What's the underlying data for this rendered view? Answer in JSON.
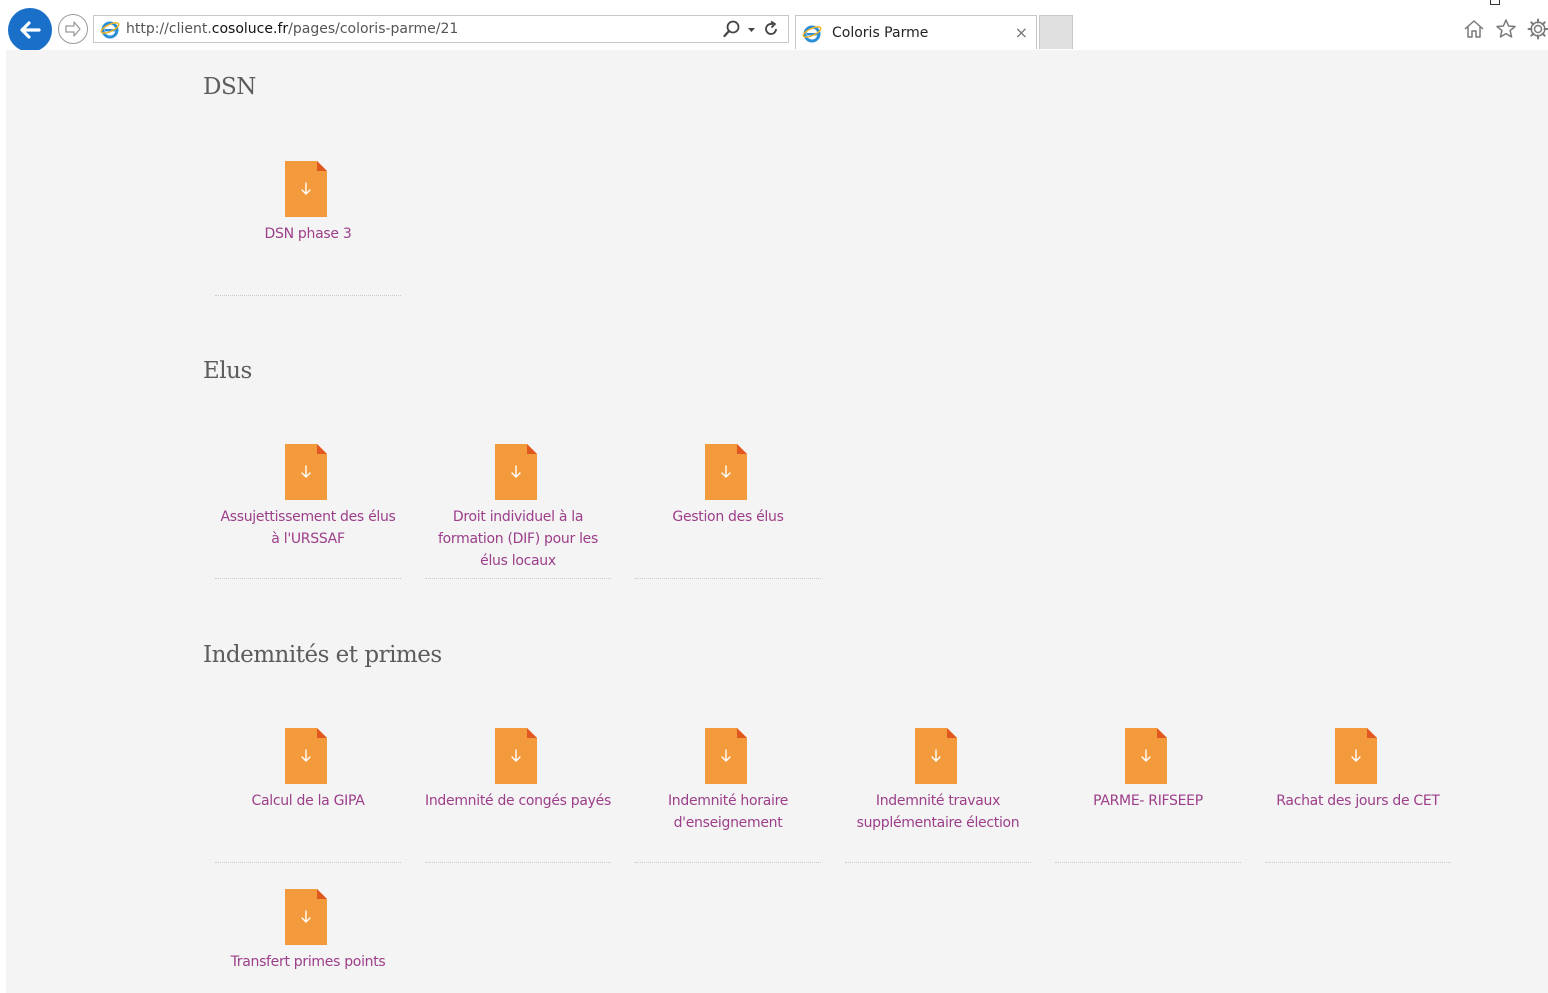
{
  "browser": {
    "url_prefix": "http://client.",
    "url_host": "cosoluce.fr",
    "url_path": "/pages/coloris-parme/21",
    "tab_title": "Coloris Parme",
    "tab_close": "×",
    "icons": [
      "back-arrow-icon",
      "forward-arrow-icon",
      "ie-logo-icon",
      "search-icon",
      "refresh-icon",
      "home-icon",
      "star-icon",
      "gear-icon"
    ]
  },
  "colors": {
    "accent_back": "#1a6fc9",
    "file_icon": "#f39a3d",
    "file_fold": "#e0571f",
    "link_text": "#9c3e8a",
    "page_bg": "#f4f4f4"
  },
  "sections": [
    {
      "title": "DSN",
      "items": [
        {
          "label": "DSN phase 3"
        }
      ]
    },
    {
      "title": "Elus",
      "items": [
        {
          "label": "Assujettissement des élus à l'URSSAF"
        },
        {
          "label": "Droit individuel à la formation (DIF) pour les élus locaux"
        },
        {
          "label": "Gestion des élus"
        }
      ]
    },
    {
      "title": "Indemnités et primes",
      "items": [
        {
          "label": "Calcul de la GIPA"
        },
        {
          "label": "Indemnité de congés payés"
        },
        {
          "label": "Indemnité horaire d'enseignement"
        },
        {
          "label": "Indemnité travaux supplémentaire élection"
        },
        {
          "label": "PARME- RIFSEEP"
        },
        {
          "label": "Rachat des jours de CET"
        },
        {
          "label": "Transfert primes points"
        }
      ]
    }
  ]
}
